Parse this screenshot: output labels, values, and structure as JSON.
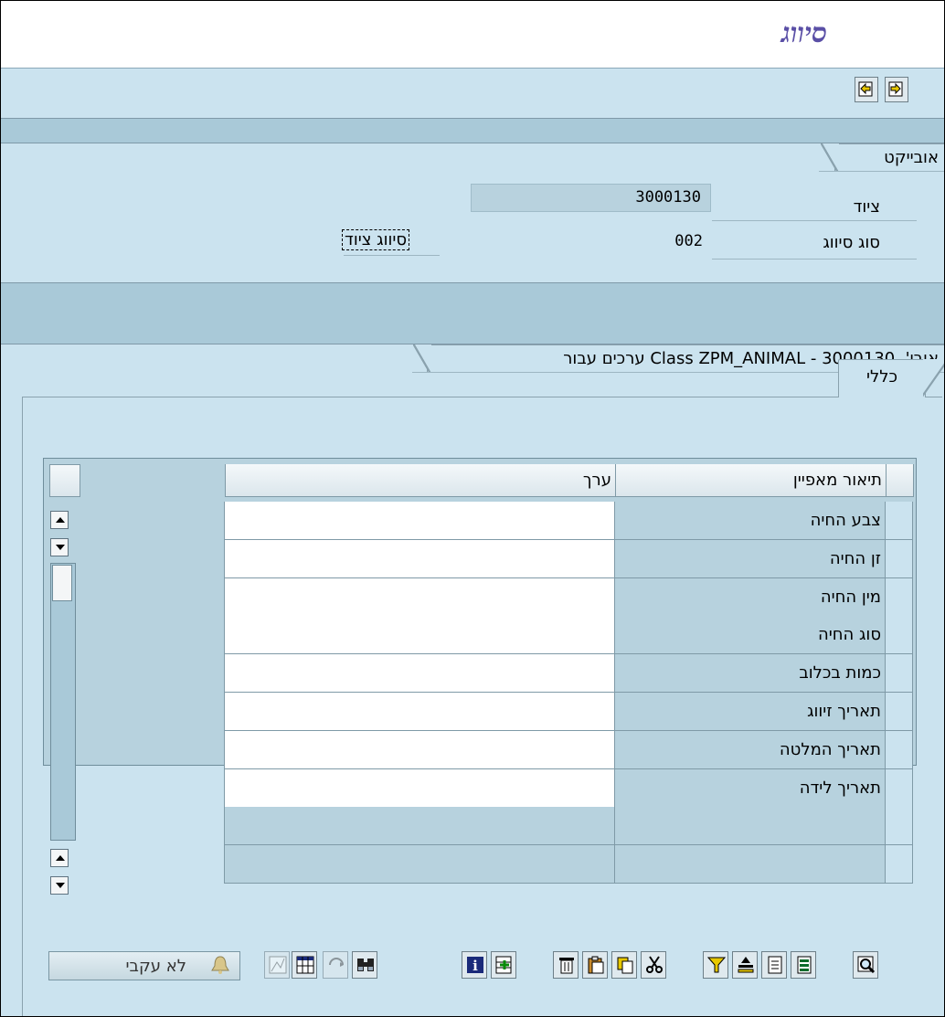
{
  "window": {
    "title": "סיווג"
  },
  "toolbar": {
    "icons": [
      "previous-object-icon",
      "next-object-icon"
    ]
  },
  "object_section": {
    "tab_label": "אובייקט",
    "equipment_label": "ציוד",
    "equipment_value": "3000130",
    "class_type_label": "סוג סיווג",
    "class_type_value": "002",
    "class_type_desc": "סיווג ציוד"
  },
  "values_section": {
    "tab_label": "ערכים עבור Class ZPM_ANIMAL - אובי'. 3000130",
    "subtab_label": "כללי",
    "columns": {
      "characteristic": "תיאור מאפיין",
      "value": "ערך"
    },
    "rows": [
      {
        "characteristic": "צבע החיה",
        "value": ""
      },
      {
        "characteristic": "זן החיה",
        "value": ""
      },
      {
        "characteristic": "מין החיה",
        "value": ""
      },
      {
        "characteristic": "סוג החיה",
        "value": ""
      },
      {
        "characteristic": "כמות בכלוב",
        "value": ""
      },
      {
        "characteristic": "תאריך זיווג",
        "value": ""
      },
      {
        "characteristic": "תאריך המלטה",
        "value": ""
      },
      {
        "characteristic": "תאריך לידה",
        "value": ""
      },
      {
        "characteristic": "",
        "value": ""
      },
      {
        "characteristic": "",
        "value": ""
      }
    ]
  },
  "footer": {
    "not_tracked_label": "לא עקבי"
  },
  "colors": {
    "title": "#5a4fa6",
    "panel": "#cbe3ef",
    "band": "#a9c9d8"
  }
}
